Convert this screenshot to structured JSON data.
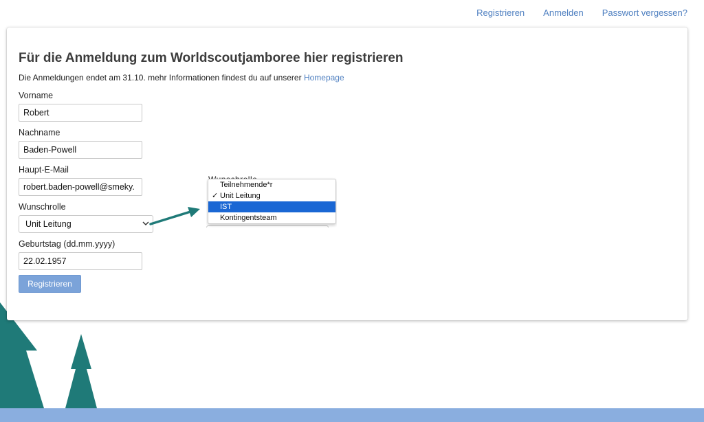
{
  "topnav": {
    "register": "Registrieren",
    "login": "Anmelden",
    "forgot": "Passwort vergessen?"
  },
  "form": {
    "title": "Für die Anmeldung zum Worldscoutjamboree hier registrieren",
    "intro_text": "Die Anmeldungen endet am 31.10. mehr Informationen findest du auf unserer ",
    "intro_link": "Homepage",
    "firstname_label": "Vorname",
    "firstname_value": "Robert",
    "lastname_label": "Nachname",
    "lastname_value": "Baden-Powell",
    "email_label": "Haupt-E-Mail",
    "email_value": "robert.baden-powell@smeky.",
    "role_label": "Wunschrolle",
    "role_value": "Unit Leitung",
    "birthday_label": "Geburtstag (dd.mm.yyyy)",
    "birthday_value": "22.02.1957",
    "submit_label": "Registrieren"
  },
  "dropdown_callout": {
    "behind_label": "Wunschrolle",
    "options": [
      "Teilnehmende*r",
      "Unit Leitung",
      "IST",
      "Kontingentsteam"
    ],
    "checked_option": "Unit Leitung",
    "highlighted_option": "IST",
    "check_mark": "✓"
  },
  "icons": {
    "chevron": "chevron-down-icon",
    "arrow": "arrow-annotation-icon"
  },
  "colors": {
    "link": "#4e7fc0",
    "button": "#7ba3d9",
    "tree": "#1f7a78",
    "footer_band": "#8aaedf",
    "highlight": "#1a67d4",
    "annotation_arrow": "#1f7a78"
  }
}
